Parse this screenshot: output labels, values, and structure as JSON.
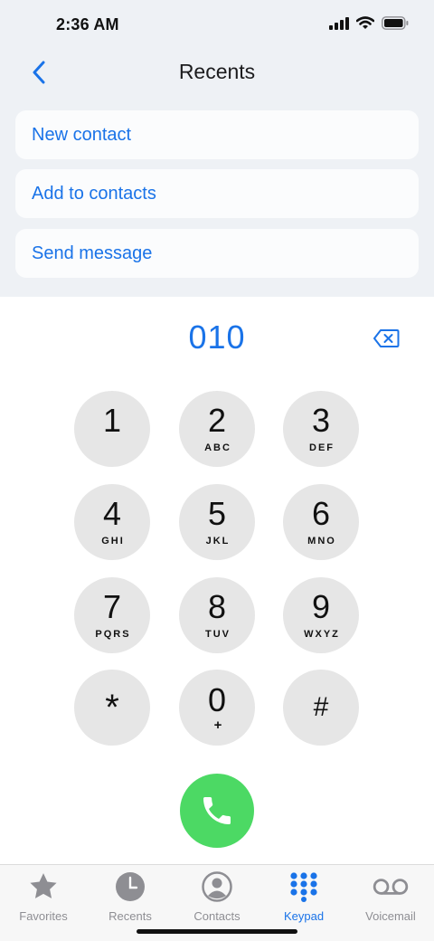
{
  "status": {
    "time": "2:36 AM"
  },
  "nav": {
    "title": "Recents"
  },
  "actions": [
    {
      "label": "New contact"
    },
    {
      "label": "Add to contacts"
    },
    {
      "label": "Send message"
    }
  ],
  "dialer": {
    "number": "010"
  },
  "keypad": [
    {
      "digit": "1",
      "letters": ""
    },
    {
      "digit": "2",
      "letters": "ABC"
    },
    {
      "digit": "3",
      "letters": "DEF"
    },
    {
      "digit": "4",
      "letters": "GHI"
    },
    {
      "digit": "5",
      "letters": "JKL"
    },
    {
      "digit": "6",
      "letters": "MNO"
    },
    {
      "digit": "7",
      "letters": "PQRS"
    },
    {
      "digit": "8",
      "letters": "TUV"
    },
    {
      "digit": "9",
      "letters": "WXYZ"
    },
    {
      "digit": "*",
      "letters": ""
    },
    {
      "digit": "0",
      "letters": "+"
    },
    {
      "digit": "#",
      "letters": ""
    }
  ],
  "tabs": [
    {
      "label": "Favorites",
      "icon": "star-icon"
    },
    {
      "label": "Recents",
      "icon": "clock-icon"
    },
    {
      "label": "Contacts",
      "icon": "person-circle-icon"
    },
    {
      "label": "Keypad",
      "icon": "keypad-grid-icon",
      "active": true
    },
    {
      "label": "Voicemail",
      "icon": "voicemail-icon"
    }
  ],
  "colors": {
    "accent": "#1a73e8",
    "call": "#4cd964",
    "key": "#e6e6e6",
    "inactive": "#8e8e93"
  }
}
